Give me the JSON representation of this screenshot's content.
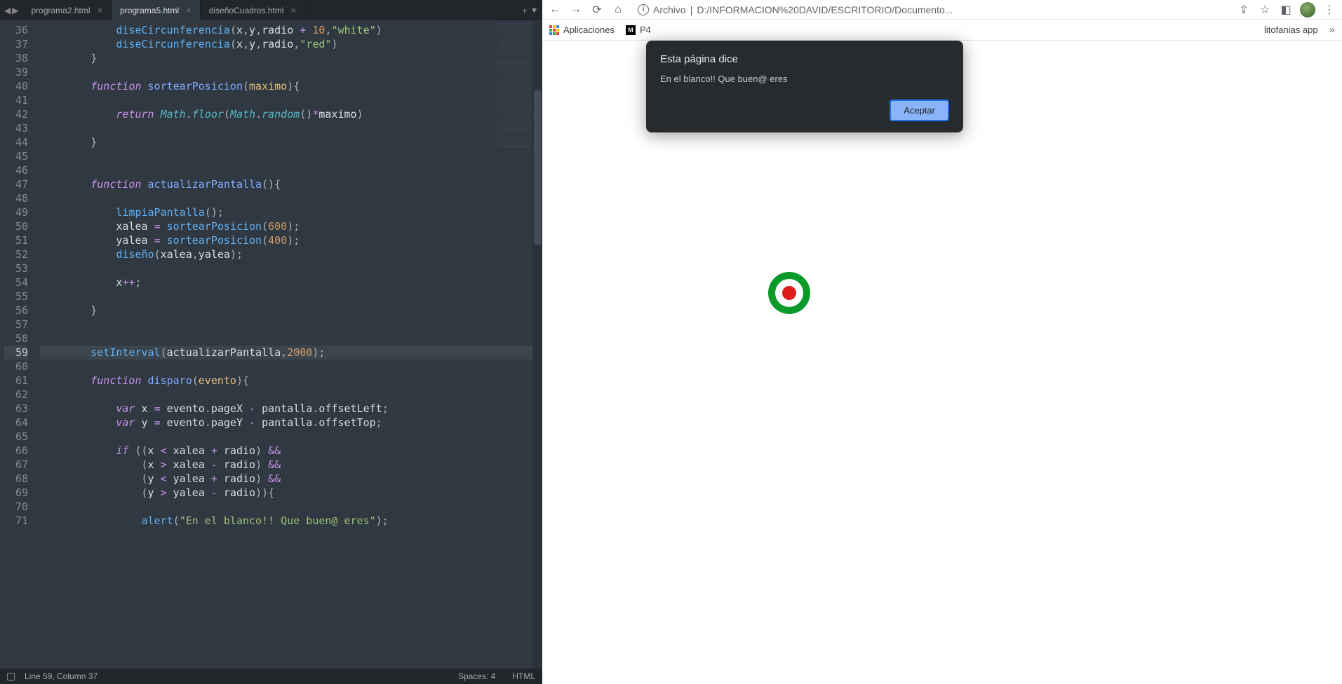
{
  "editor": {
    "tabs": [
      {
        "label": "programa2.html",
        "active": false
      },
      {
        "label": "programa5.html",
        "active": true
      },
      {
        "label": "diseñoCuadros.html",
        "active": false
      }
    ],
    "first_line_number": 36,
    "highlighted_line": 59,
    "lines": [
      {
        "n": 36,
        "html": "            <span class='c-call'>diseCircunferencia</span><span class='c-pn'>(</span><span class='c-var'>x</span><span class='c-pn'>,</span><span class='c-var'>y</span><span class='c-pn'>,</span><span class='c-var'>radio</span> <span class='c-op'>+</span> <span class='c-num'>10</span><span class='c-pn'>,</span><span class='c-str'>\"white\"</span><span class='c-pn'>)</span>"
      },
      {
        "n": 37,
        "html": "            <span class='c-call'>diseCircunferencia</span><span class='c-pn'>(</span><span class='c-var'>x</span><span class='c-pn'>,</span><span class='c-var'>y</span><span class='c-pn'>,</span><span class='c-var'>radio</span><span class='c-pn'>,</span><span class='c-str'>\"red\"</span><span class='c-pn'>)</span>"
      },
      {
        "n": 38,
        "html": "        <span class='c-pn'>}</span>"
      },
      {
        "n": 39,
        "html": ""
      },
      {
        "n": 40,
        "html": "        <span class='c-kw'>function</span> <span class='c-fn'>sortearPosicion</span><span class='c-pn'>(</span><span class='c-param'>maximo</span><span class='c-pn'>){</span>"
      },
      {
        "n": 41,
        "html": ""
      },
      {
        "n": 42,
        "html": "            <span class='c-kw'>return</span> <span class='c-obj'>Math</span><span class='c-pn'>.</span><span class='c-call2'>floor</span><span class='c-pn'>(</span><span class='c-obj'>Math</span><span class='c-pn'>.</span><span class='c-call2'>random</span><span class='c-pn'>()</span><span class='c-op'>*</span><span class='c-var'>maximo</span><span class='c-pn'>)</span>"
      },
      {
        "n": 43,
        "html": ""
      },
      {
        "n": 44,
        "html": "        <span class='c-pn'>}</span>"
      },
      {
        "n": 45,
        "html": ""
      },
      {
        "n": 46,
        "html": ""
      },
      {
        "n": 47,
        "html": "        <span class='c-kw'>function</span> <span class='c-fn'>actualizarPantalla</span><span class='c-pn'>(){</span>"
      },
      {
        "n": 48,
        "html": ""
      },
      {
        "n": 49,
        "html": "            <span class='c-call'>limpiaPantalla</span><span class='c-pn'>();</span>"
      },
      {
        "n": 50,
        "html": "            <span class='c-var'>xalea</span> <span class='c-op'>=</span> <span class='c-call'>sortearPosicion</span><span class='c-pn'>(</span><span class='c-num'>600</span><span class='c-pn'>);</span>"
      },
      {
        "n": 51,
        "html": "            <span class='c-var'>yalea</span> <span class='c-op'>=</span> <span class='c-call'>sortearPosicion</span><span class='c-pn'>(</span><span class='c-num'>400</span><span class='c-pn'>);</span>"
      },
      {
        "n": 52,
        "html": "            <span class='c-call'>diseño</span><span class='c-pn'>(</span><span class='c-var'>xalea</span><span class='c-pn'>,</span><span class='c-var'>yalea</span><span class='c-pn'>);</span>"
      },
      {
        "n": 53,
        "html": ""
      },
      {
        "n": 54,
        "html": "            <span class='c-var'>x</span><span class='c-op'>++</span><span class='c-pn'>;</span>"
      },
      {
        "n": 55,
        "html": ""
      },
      {
        "n": 56,
        "html": "        <span class='c-pn'>}</span>"
      },
      {
        "n": 57,
        "html": ""
      },
      {
        "n": 58,
        "html": ""
      },
      {
        "n": 59,
        "html": "        <span class='c-call'>setInterval</span><span class='c-pn'>(</span><span class='c-var'>actualizarPantalla</span><span class='c-pn'>,</span><span class='c-num'>2000</span><span class='c-pn'>);</span>"
      },
      {
        "n": 60,
        "html": ""
      },
      {
        "n": 61,
        "html": "        <span class='c-kw'>function</span> <span class='c-fn'>disparo</span><span class='c-pn'>(</span><span class='c-param'>evento</span><span class='c-pn'>){</span>"
      },
      {
        "n": 62,
        "html": ""
      },
      {
        "n": 63,
        "html": "            <span class='c-kw'>var</span> <span class='c-var'>x</span> <span class='c-op'>=</span> <span class='c-var'>evento</span><span class='c-pn'>.</span><span class='c-var'>pageX</span> <span class='c-op'>-</span> <span class='c-var'>pantalla</span><span class='c-pn'>.</span><span class='c-var'>offsetLeft</span><span class='c-pn'>;</span>"
      },
      {
        "n": 64,
        "html": "            <span class='c-kw'>var</span> <span class='c-var'>y</span> <span class='c-op'>=</span> <span class='c-var'>evento</span><span class='c-pn'>.</span><span class='c-var'>pageY</span> <span class='c-op'>-</span> <span class='c-var'>pantalla</span><span class='c-pn'>.</span><span class='c-var'>offsetTop</span><span class='c-pn'>;</span>"
      },
      {
        "n": 65,
        "html": ""
      },
      {
        "n": 66,
        "html": "            <span class='c-kw'>if</span> <span class='c-pn'>((</span><span class='c-var'>x</span> <span class='c-op'>&lt;</span> <span class='c-var'>xalea</span> <span class='c-op'>+</span> <span class='c-var'>radio</span><span class='c-pn'>)</span> <span class='c-op'>&amp;&amp;</span>"
      },
      {
        "n": 67,
        "html": "                <span class='c-pn'>(</span><span class='c-var'>x</span> <span class='c-op'>&gt;</span> <span class='c-var'>xalea</span> <span class='c-op'>-</span> <span class='c-var'>radio</span><span class='c-pn'>)</span> <span class='c-op'>&amp;&amp;</span>"
      },
      {
        "n": 68,
        "html": "                <span class='c-pn'>(</span><span class='c-var'>y</span> <span class='c-op'>&lt;</span> <span class='c-var'>yalea</span> <span class='c-op'>+</span> <span class='c-var'>radio</span><span class='c-pn'>)</span> <span class='c-op'>&amp;&amp;</span>"
      },
      {
        "n": 69,
        "html": "                <span class='c-pn'>(</span><span class='c-var'>y</span> <span class='c-op'>&gt;</span> <span class='c-var'>yalea</span> <span class='c-op'>-</span> <span class='c-var'>radio</span><span class='c-pn'>)){</span>"
      },
      {
        "n": 70,
        "html": ""
      },
      {
        "n": 71,
        "html": "                <span class='c-call'>alert</span><span class='c-pn'>(</span><span class='c-str'>\"En el blanco!! Que buen@ eres\"</span><span class='c-pn'>);</span>"
      }
    ],
    "status": {
      "cursor": "Line 59, Column 37",
      "spaces": "Spaces: 4",
      "lang": "HTML"
    }
  },
  "browser": {
    "address_prefix": "Archivo",
    "address_path": "D:/INFORMACION%20DAVID/ESCRITORIO/Documento...",
    "bookmarks": {
      "apps": "Aplicaciones",
      "p4": "P4",
      "lito": "litofanias app"
    },
    "dialog": {
      "title": "Esta página dice",
      "message": "En el blanco!! Que buen@ eres",
      "accept": "Aceptar"
    }
  }
}
